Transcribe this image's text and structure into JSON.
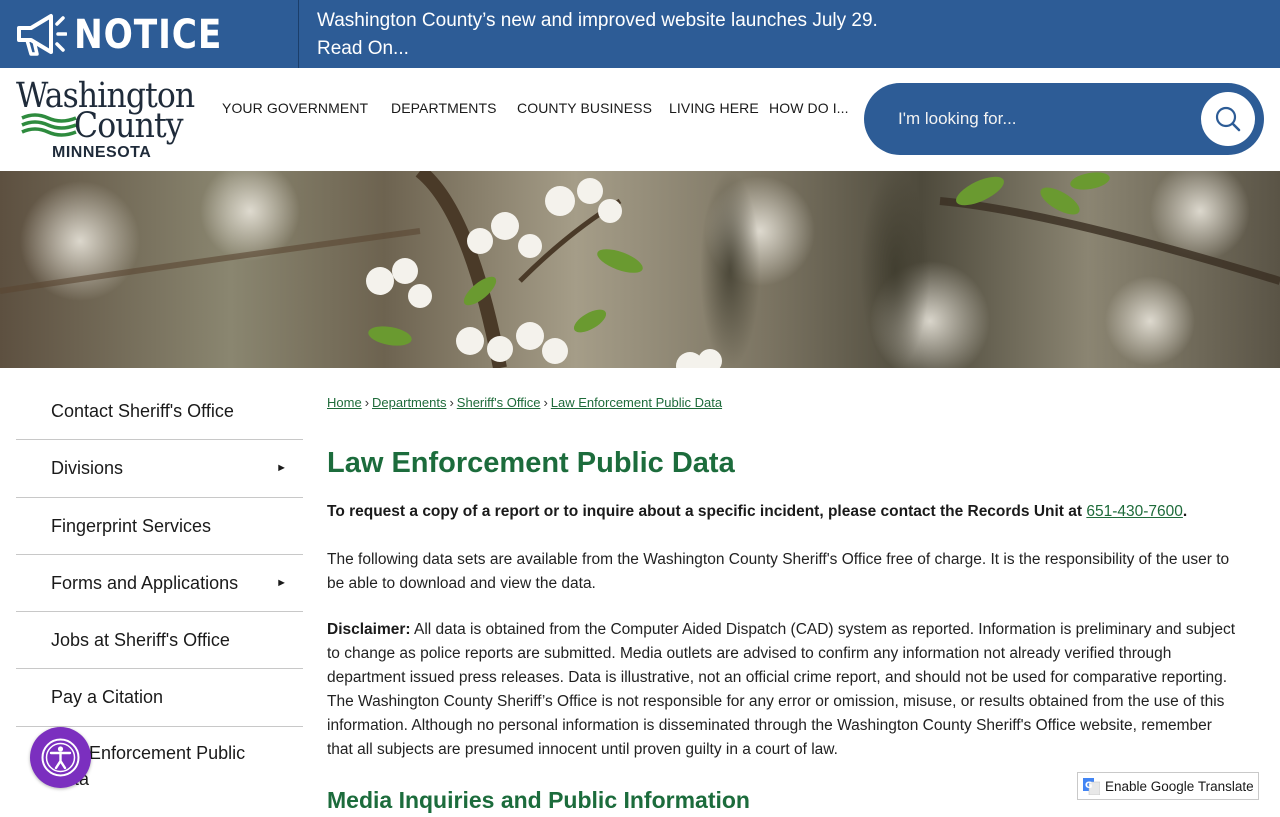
{
  "notice": {
    "icon": "megaphone-icon",
    "title": "NOTICE",
    "message_line1": "Washington County’s new and improved website launches July 29.",
    "message_line2": "Read On..."
  },
  "logo": {
    "line1": "Washington",
    "line2": "County",
    "line3": "MINNESOTA"
  },
  "nav": {
    "items": [
      {
        "label": "YOUR GOVERNMENT"
      },
      {
        "label": "DEPARTMENTS"
      },
      {
        "label": "COUNTY BUSINESS"
      },
      {
        "label": "LIVING HERE"
      },
      {
        "label": "HOW DO I..."
      }
    ]
  },
  "search": {
    "placeholder": "I'm looking for...",
    "icon": "search-icon"
  },
  "sidebar": {
    "items": [
      {
        "label": "Contact Sheriff's Office",
        "has_submenu": false
      },
      {
        "label": "Divisions",
        "has_submenu": true
      },
      {
        "label": "Fingerprint Services",
        "has_submenu": false
      },
      {
        "label": "Forms and Applications",
        "has_submenu": true
      },
      {
        "label": "Jobs at Sheriff's Office",
        "has_submenu": false
      },
      {
        "label": "Pay a Citation",
        "has_submenu": false
      },
      {
        "label": "Law Enforcement Public Data",
        "has_submenu": false
      }
    ],
    "arrow_glyph": "►"
  },
  "breadcrumb": {
    "items": [
      "Home",
      "Departments",
      "Sheriff's Office",
      "Law Enforcement Public Data"
    ],
    "separator": "›"
  },
  "main": {
    "title": "Law Enforcement Public Data",
    "intro_text": "To request a copy of a report or to inquire about a specific incident, please contact the Records Unit at ",
    "intro_phone": "651-430-7600",
    "intro_end": ".",
    "paragraph1": "The following data sets are available from the Washington County Sheriff's Office free of charge. It is the responsibility of the user to be able to download and view the data.",
    "disclaimer_label": "Disclaimer:",
    "disclaimer_text": " All data is obtained from the Computer Aided Dispatch (CAD) system as reported. Information is preliminary and subject to change as police reports are submitted. Media outlets are advised to confirm any information not already verified through department issued press releases. Data is illustrative, not an official crime report, and should not be used for comparative reporting. The Washington County Sheriff’s Office is not responsible for any error or omission, misuse, or results obtained from the use of this information. Although no personal information is disseminated through the Washington County Sheriff's Office website, remember that all subjects are presumed innocent until proven guilty in a court of law.",
    "sub_heading": "Media Inquiries and Public Information"
  },
  "accessibility": {
    "icon": "accessibility-icon"
  },
  "translate": {
    "label": "Enable Google Translate",
    "icon": "google-translate-icon"
  },
  "colors": {
    "brand_blue": "#2d5c96",
    "brand_green": "#1c6c3c",
    "accessibility_purple": "#7b2fbf"
  }
}
